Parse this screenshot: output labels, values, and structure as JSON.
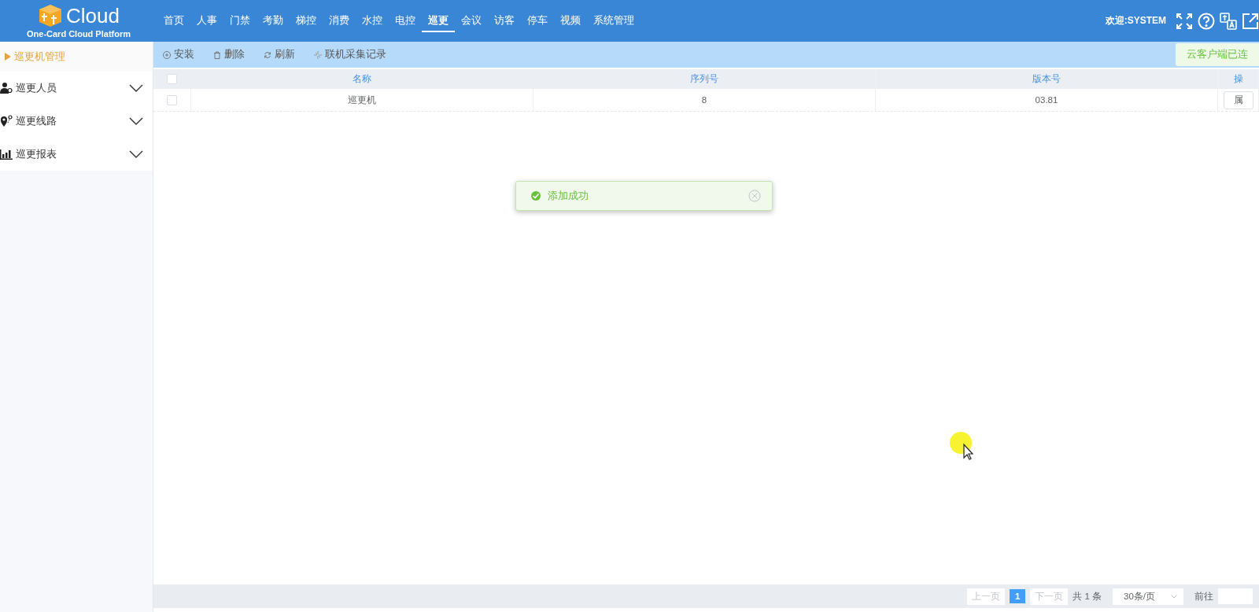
{
  "header": {
    "logo_text": "Cloud",
    "logo_subtitle": "One-Card Cloud Platform",
    "nav": [
      {
        "label": "首页",
        "selected": false
      },
      {
        "label": "人事",
        "selected": false
      },
      {
        "label": "门禁",
        "selected": false
      },
      {
        "label": "考勤",
        "selected": false
      },
      {
        "label": "梯控",
        "selected": false
      },
      {
        "label": "消费",
        "selected": false
      },
      {
        "label": "水控",
        "selected": false
      },
      {
        "label": "电控",
        "selected": false
      },
      {
        "label": "巡更",
        "selected": true
      },
      {
        "label": "会议",
        "selected": false
      },
      {
        "label": "访客",
        "selected": false
      },
      {
        "label": "停车",
        "selected": false
      },
      {
        "label": "视频",
        "selected": false
      },
      {
        "label": "系统管理",
        "selected": false
      }
    ],
    "welcome": "欢迎:SYSTEM"
  },
  "sidebar": {
    "items": [
      {
        "kind": "link",
        "label": "巡更机管理",
        "selected": true
      },
      {
        "kind": "group",
        "label": "巡更人员",
        "expanded": false
      },
      {
        "kind": "group",
        "label": "巡更线路",
        "expanded": false
      },
      {
        "kind": "group",
        "label": "巡更报表",
        "expanded": false
      }
    ]
  },
  "toolbar": {
    "buttons": [
      "安装",
      "删除",
      "刷新",
      "联机采集记录"
    ],
    "status": "云客户端已连"
  },
  "table": {
    "all_checked": false,
    "columns": [
      "名称",
      "序列号",
      "版本号",
      "操"
    ],
    "rows": [
      {
        "checked": false,
        "cells": [
          "巡更机",
          "8",
          "03.81"
        ],
        "action": "属"
      }
    ]
  },
  "pagination": {
    "prev": {
      "label": "上一页",
      "disabled": true
    },
    "pages": [
      {
        "label": "1",
        "selected": true
      }
    ],
    "next": {
      "label": "下一页",
      "disabled": true
    },
    "total": "共 1 条",
    "page_size": "30条/页",
    "goto": "前往"
  },
  "toast": {
    "kind": "success",
    "message": "添加成功"
  }
}
